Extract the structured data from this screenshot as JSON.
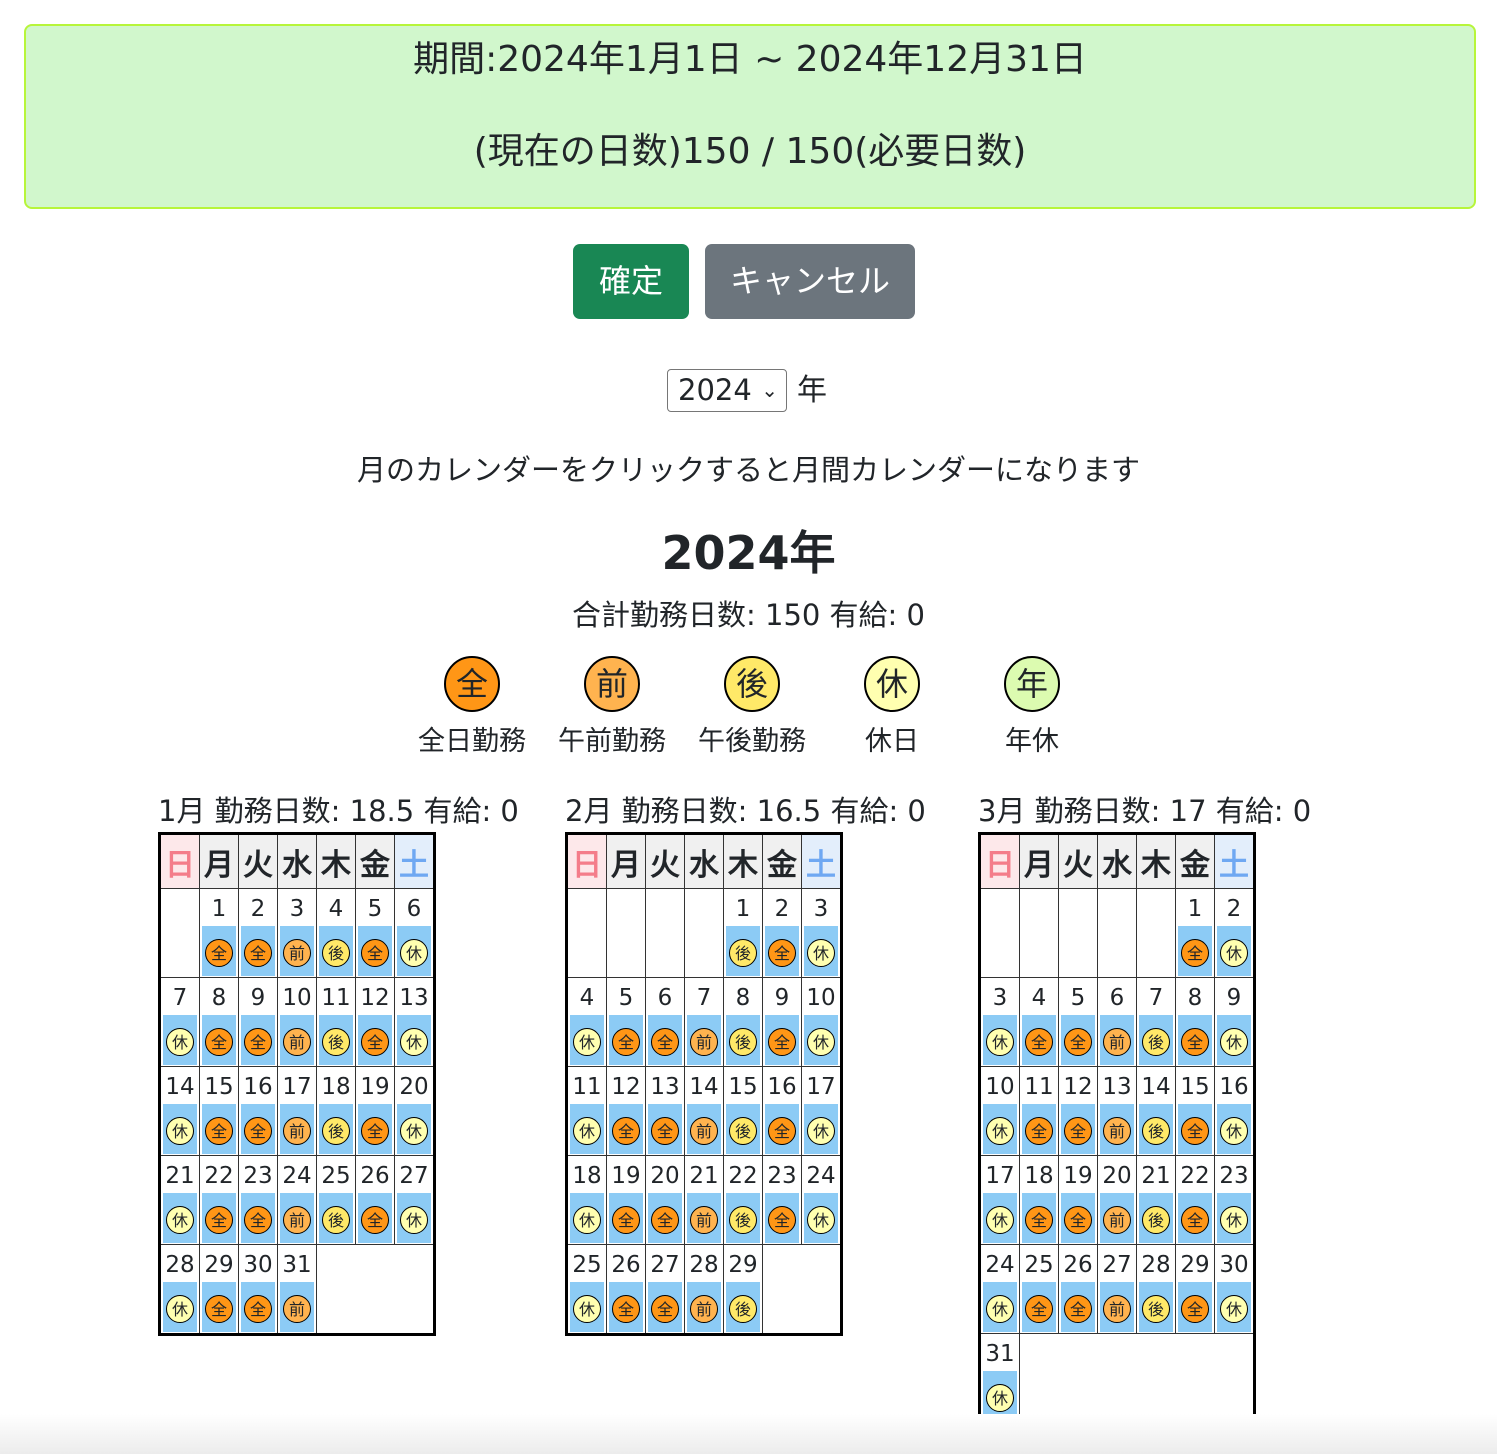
{
  "banner": {
    "period": "期間:2024年1月1日 ~ 2024年12月31日",
    "counts": "(現在の日数)150 / 150(必要日数)"
  },
  "buttons": {
    "confirm": "確定",
    "cancel": "キャンセル"
  },
  "year_select": {
    "value": "2024",
    "suffix": "年"
  },
  "hint": "月のカレンダーをクリックすると月間カレンダーになります",
  "year_title": "2024年",
  "year_summary": "合計勤務日数: 150 有給: 0",
  "legend": [
    {
      "mark": "全",
      "label": "全日勤務",
      "color": "#ff9616"
    },
    {
      "mark": "前",
      "label": "午前勤務",
      "color": "#ffb34f"
    },
    {
      "mark": "後",
      "label": "午後勤務",
      "color": "#ffe968"
    },
    {
      "mark": "休",
      "label": "休日",
      "color": "#ffffb0"
    },
    {
      "mark": "年",
      "label": "年休",
      "color": "#dcfbb0"
    }
  ],
  "weekdays": [
    "日",
    "月",
    "火",
    "水",
    "木",
    "金",
    "土"
  ],
  "months": [
    {
      "title": "1月 勤務日数: 18.5 有給: 0",
      "weeks": [
        [
          null,
          {
            "d": "1",
            "s": "全"
          },
          {
            "d": "2",
            "s": "全"
          },
          {
            "d": "3",
            "s": "前"
          },
          {
            "d": "4",
            "s": "後"
          },
          {
            "d": "5",
            "s": "全"
          },
          {
            "d": "6",
            "s": "休"
          }
        ],
        [
          {
            "d": "7",
            "s": "休"
          },
          {
            "d": "8",
            "s": "全"
          },
          {
            "d": "9",
            "s": "全"
          },
          {
            "d": "10",
            "s": "前"
          },
          {
            "d": "11",
            "s": "後"
          },
          {
            "d": "12",
            "s": "全"
          },
          {
            "d": "13",
            "s": "休"
          }
        ],
        [
          {
            "d": "14",
            "s": "休"
          },
          {
            "d": "15",
            "s": "全"
          },
          {
            "d": "16",
            "s": "全"
          },
          {
            "d": "17",
            "s": "前"
          },
          {
            "d": "18",
            "s": "後"
          },
          {
            "d": "19",
            "s": "全"
          },
          {
            "d": "20",
            "s": "休"
          }
        ],
        [
          {
            "d": "21",
            "s": "休"
          },
          {
            "d": "22",
            "s": "全"
          },
          {
            "d": "23",
            "s": "全"
          },
          {
            "d": "24",
            "s": "前"
          },
          {
            "d": "25",
            "s": "後"
          },
          {
            "d": "26",
            "s": "全"
          },
          {
            "d": "27",
            "s": "休"
          }
        ],
        [
          {
            "d": "28",
            "s": "休"
          },
          {
            "d": "29",
            "s": "全"
          },
          {
            "d": "30",
            "s": "全"
          },
          {
            "d": "31",
            "s": "前"
          }
        ]
      ]
    },
    {
      "title": "2月 勤務日数: 16.5 有給: 0",
      "weeks": [
        [
          null,
          null,
          null,
          null,
          {
            "d": "1",
            "s": "後"
          },
          {
            "d": "2",
            "s": "全"
          },
          {
            "d": "3",
            "s": "休"
          }
        ],
        [
          {
            "d": "4",
            "s": "休"
          },
          {
            "d": "5",
            "s": "全"
          },
          {
            "d": "6",
            "s": "全"
          },
          {
            "d": "7",
            "s": "前"
          },
          {
            "d": "8",
            "s": "後"
          },
          {
            "d": "9",
            "s": "全"
          },
          {
            "d": "10",
            "s": "休"
          }
        ],
        [
          {
            "d": "11",
            "s": "休"
          },
          {
            "d": "12",
            "s": "全"
          },
          {
            "d": "13",
            "s": "全"
          },
          {
            "d": "14",
            "s": "前"
          },
          {
            "d": "15",
            "s": "後"
          },
          {
            "d": "16",
            "s": "全"
          },
          {
            "d": "17",
            "s": "休"
          }
        ],
        [
          {
            "d": "18",
            "s": "休"
          },
          {
            "d": "19",
            "s": "全"
          },
          {
            "d": "20",
            "s": "全"
          },
          {
            "d": "21",
            "s": "前"
          },
          {
            "d": "22",
            "s": "後"
          },
          {
            "d": "23",
            "s": "全"
          },
          {
            "d": "24",
            "s": "休"
          }
        ],
        [
          {
            "d": "25",
            "s": "休"
          },
          {
            "d": "26",
            "s": "全"
          },
          {
            "d": "27",
            "s": "全"
          },
          {
            "d": "28",
            "s": "前"
          },
          {
            "d": "29",
            "s": "後"
          }
        ]
      ]
    },
    {
      "title": "3月 勤務日数: 17 有給: 0",
      "weeks": [
        [
          null,
          null,
          null,
          null,
          null,
          {
            "d": "1",
            "s": "全"
          },
          {
            "d": "2",
            "s": "休"
          }
        ],
        [
          {
            "d": "3",
            "s": "休"
          },
          {
            "d": "4",
            "s": "全"
          },
          {
            "d": "5",
            "s": "全"
          },
          {
            "d": "6",
            "s": "前"
          },
          {
            "d": "7",
            "s": "後"
          },
          {
            "d": "8",
            "s": "全"
          },
          {
            "d": "9",
            "s": "休"
          }
        ],
        [
          {
            "d": "10",
            "s": "休"
          },
          {
            "d": "11",
            "s": "全"
          },
          {
            "d": "12",
            "s": "全"
          },
          {
            "d": "13",
            "s": "前"
          },
          {
            "d": "14",
            "s": "後"
          },
          {
            "d": "15",
            "s": "全"
          },
          {
            "d": "16",
            "s": "休"
          }
        ],
        [
          {
            "d": "17",
            "s": "休"
          },
          {
            "d": "18",
            "s": "全"
          },
          {
            "d": "19",
            "s": "全"
          },
          {
            "d": "20",
            "s": "前"
          },
          {
            "d": "21",
            "s": "後"
          },
          {
            "d": "22",
            "s": "全"
          },
          {
            "d": "23",
            "s": "休"
          }
        ],
        [
          {
            "d": "24",
            "s": "休"
          },
          {
            "d": "25",
            "s": "全"
          },
          {
            "d": "26",
            "s": "全"
          },
          {
            "d": "27",
            "s": "前"
          },
          {
            "d": "28",
            "s": "後"
          },
          {
            "d": "29",
            "s": "全"
          },
          {
            "d": "30",
            "s": "休"
          }
        ],
        [
          {
            "d": "31",
            "s": "休"
          }
        ]
      ]
    }
  ]
}
